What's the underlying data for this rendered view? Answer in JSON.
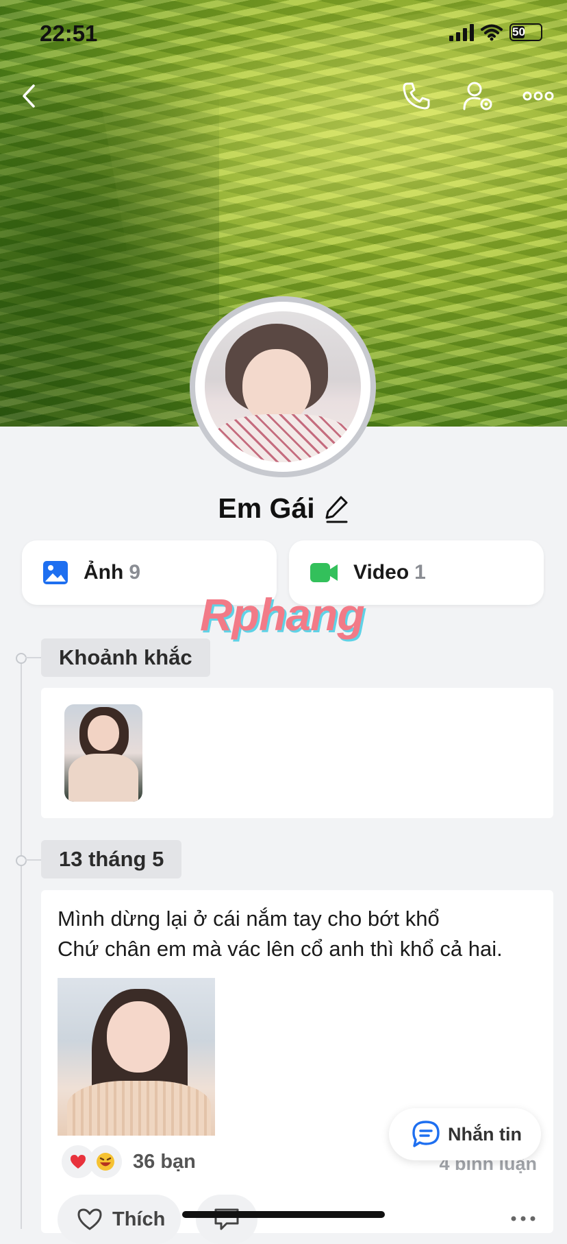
{
  "status_bar": {
    "time": "22:51",
    "battery_level": "50"
  },
  "profile": {
    "name": "Em Gái"
  },
  "media": {
    "photos": {
      "label": "Ảnh",
      "count": "9"
    },
    "videos": {
      "label": "Video",
      "count": "1"
    }
  },
  "watermark": "Rphang",
  "moments": {
    "tag": "Khoảnh khắc"
  },
  "post": {
    "date": "13 tháng 5",
    "text_line1": "Mình dừng lại ở cái nắm tay cho bớt khổ",
    "text_line2": "Chứ chân em mà vác lên cổ anh thì khổ cả hai.",
    "reaction_count": "36 bạn",
    "comment_count": "4 bình luận",
    "like_label": "Thích"
  },
  "message_button": {
    "label": "Nhắn tin"
  },
  "colors": {
    "accent_blue": "#1e6ff0",
    "video_green": "#33c05b",
    "like_red": "#e8323c"
  },
  "icons": [
    "back-icon",
    "phone-icon",
    "user-settings-icon",
    "more-icon",
    "edit-icon",
    "image-icon",
    "video-camera-icon",
    "heart-reaction-icon",
    "laugh-reaction-icon",
    "heart-outline-icon",
    "comment-icon",
    "chat-icon"
  ]
}
